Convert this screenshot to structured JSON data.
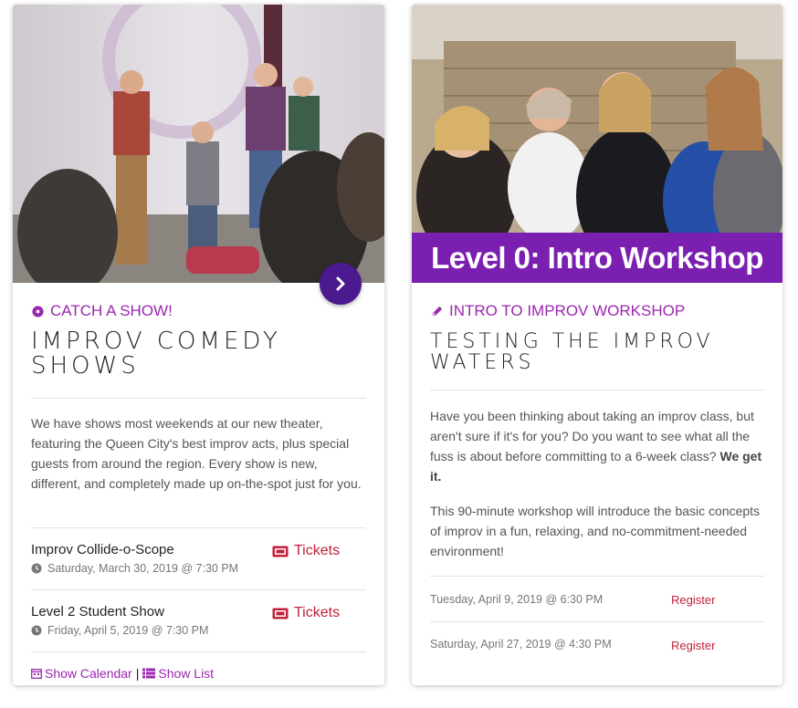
{
  "card1": {
    "eyebrow": "CATCH A SHOW!",
    "title_line1": "IMPROV COMEDY",
    "title_line2": "SHOWS",
    "description": "We have shows most weekends at our new theater, featuring the Queen City's best improv acts, plus special guests from around the region. Every show is new, different, and completely made up on-the-spot just for you.",
    "events": [
      {
        "name": "Improv Collide-o-Scope",
        "date": "Saturday, March 30, 2019 @ 7:30 PM",
        "action": "Tickets"
      },
      {
        "name": "Level 2 Student Show",
        "date": "Friday, April 5, 2019 @ 7:30 PM",
        "action": "Tickets"
      }
    ],
    "footer": {
      "calendar": "Show Calendar",
      "separator": "|",
      "list": "Show List"
    }
  },
  "card2": {
    "banner": "Level 0: Intro Workshop",
    "eyebrow": "INTRO TO IMPROV WORKSHOP",
    "title_line1": "TESTING THE IMPROV",
    "title_line2": "WATERS",
    "para1_a": "Have you been thinking about taking an improv class, but aren't sure if it's for you? Do you want to see what all the fuss is about before committing to a 6-week class?",
    "para1_b": "We get it.",
    "para2": "This 90-minute workshop will introduce the basic concepts of improv in a fun, relaxing, and no-commitment-needed environment!",
    "sessions": [
      {
        "date": "Tuesday, April 9, 2019 @ 6:30 PM",
        "action": "Register"
      },
      {
        "date": "Saturday, April 27, 2019 @ 4:30 PM",
        "action": "Register"
      }
    ]
  },
  "icons": {
    "card1_eyebrow": "badge-icon",
    "card2_eyebrow": "pen-icon",
    "arrow": "chevron-right-icon",
    "tickets": "ticket-icon",
    "clock": "clock-icon",
    "calendar": "calendar-icon",
    "list": "list-icon"
  },
  "colors": {
    "accent": "#9b27af",
    "arrow_button": "#4b1a8f",
    "link_red": "#c0213a",
    "banner": "#7a1fb0"
  }
}
